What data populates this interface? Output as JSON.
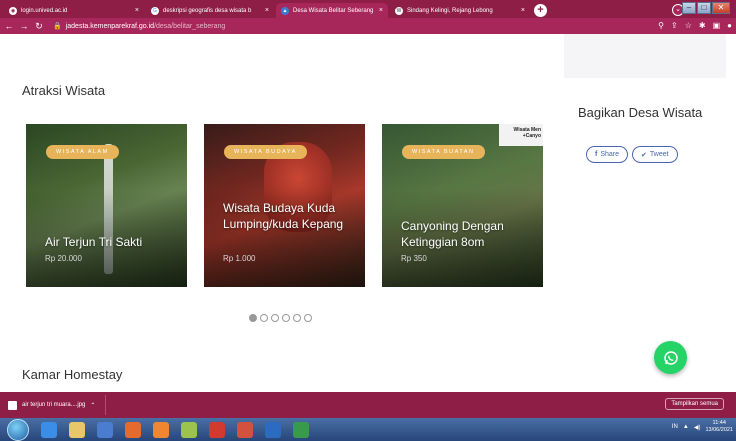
{
  "browser": {
    "tabs": [
      {
        "label": "login.unived.ac.id",
        "active": false,
        "icon": "globe-icon"
      },
      {
        "label": "deskripsi geografis desa wisata b",
        "active": false,
        "icon": "google-icon"
      },
      {
        "label": "Desa Wisata Belitar Seberang",
        "active": true,
        "icon": "site-icon"
      },
      {
        "label": "Sindang Kelingi, Rejang Lebong",
        "active": false,
        "icon": "wikipedia-icon"
      }
    ],
    "new_tab": "+",
    "url_host": "jadesta.kemenparekraf.go.id",
    "url_path": "/desa/belitar_seberang"
  },
  "page": {
    "atraksi_title": "Atraksi Wisata",
    "bagikan_title": "Bagikan Desa Wisata",
    "share_facebook": "Share",
    "share_twitter": "Tweet",
    "homestay_title": "Kamar Homestay",
    "cards": [
      {
        "badge": "WISATA ALAM",
        "title": "Air Terjun Tri Sakti",
        "price": "Rp 20.000"
      },
      {
        "badge": "WISATA BUDAYA",
        "title": "Wisata Budaya Kuda Lumping/kuda Kepang",
        "price": "Rp 1.000"
      },
      {
        "badge": "WISATA BUATAN",
        "title": "Canyoning Dengan Ketinggian 8om",
        "price": "Rp 350",
        "corner": "Wisata Men +Canyo"
      }
    ],
    "carousel_dots": 6,
    "carousel_active": 0
  },
  "downloads": {
    "file": "air terjun tri muara....jpg",
    "show_all": "Tampilkan semua"
  },
  "taskbar": {
    "lang": "IN",
    "time": "11:44",
    "date": "13/06/2021"
  }
}
